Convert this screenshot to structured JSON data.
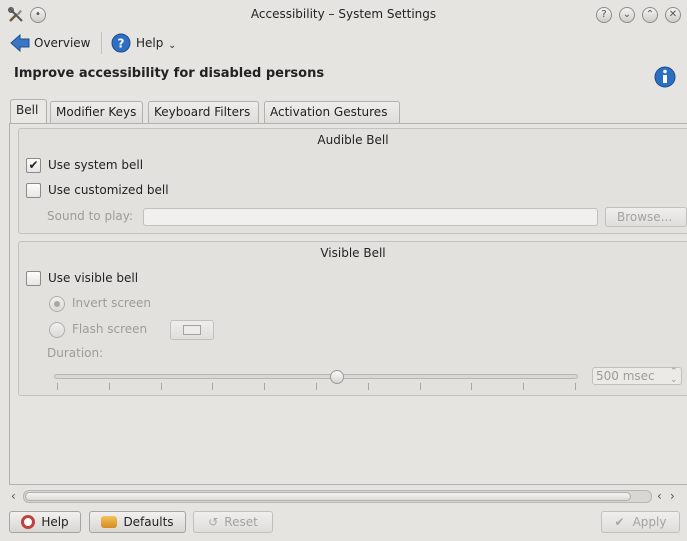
{
  "window": {
    "title": "Accessibility – System Settings",
    "icon": "tools-icon",
    "controls": [
      "help-icon",
      "minimize-icon",
      "maximize-icon",
      "close-icon"
    ]
  },
  "toolbar": {
    "overview_label": "Overview",
    "help_label": "Help"
  },
  "header": {
    "title": "Improve accessibility for disabled persons"
  },
  "tabs": [
    {
      "label": "Bell",
      "active": true
    },
    {
      "label": "Modifier Keys",
      "active": false
    },
    {
      "label": "Keyboard Filters",
      "active": false
    },
    {
      "label": "Activation Gestures",
      "active": false
    }
  ],
  "audible_bell": {
    "title": "Audible Bell",
    "use_system_bell": {
      "label": "Use system bell",
      "checked": true
    },
    "use_customized_bell": {
      "label": "Use customized bell",
      "checked": false
    },
    "sound_label": "Sound to play:",
    "sound_value": "",
    "browse_label": "Browse..."
  },
  "visible_bell": {
    "title": "Visible Bell",
    "use_visible_bell": {
      "label": "Use visible bell",
      "checked": false
    },
    "invert_screen": {
      "label": "Invert screen",
      "selected": true
    },
    "flash_screen": {
      "label": "Flash screen",
      "selected": false
    },
    "duration_label": "Duration:",
    "duration_value": "500 msec",
    "duration_slider_fraction": 0.54
  },
  "footer": {
    "help_label": "Help",
    "defaults_label": "Defaults",
    "reset_label": "Reset",
    "apply_label": "Apply"
  },
  "colors": {
    "background": "#e6e4e1",
    "accent_blue": "#2a6fc0",
    "disabled_text": "#9e9c99"
  }
}
